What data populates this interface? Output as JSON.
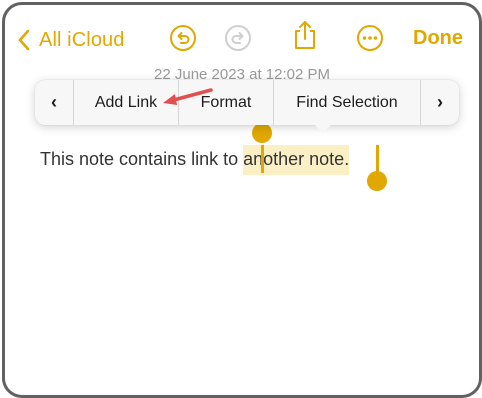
{
  "toolbar": {
    "back_label": "All iCloud",
    "done_label": "Done",
    "icons": [
      "chevron-left-icon",
      "undo-icon",
      "redo-icon",
      "share-icon",
      "more-icon"
    ],
    "accent_color": "#e0a800"
  },
  "note": {
    "date": "22 June 2023 at 12:02 PM",
    "text_before": "This note contains link to ",
    "selected_text": "another note.",
    "selection_color": "#fbefc6"
  },
  "context_menu": {
    "prev_label": "‹",
    "next_label": "›",
    "items": [
      "Add Link",
      "Format",
      "Find Selection"
    ]
  },
  "annotation": {
    "arrow_color": "#e05050"
  }
}
